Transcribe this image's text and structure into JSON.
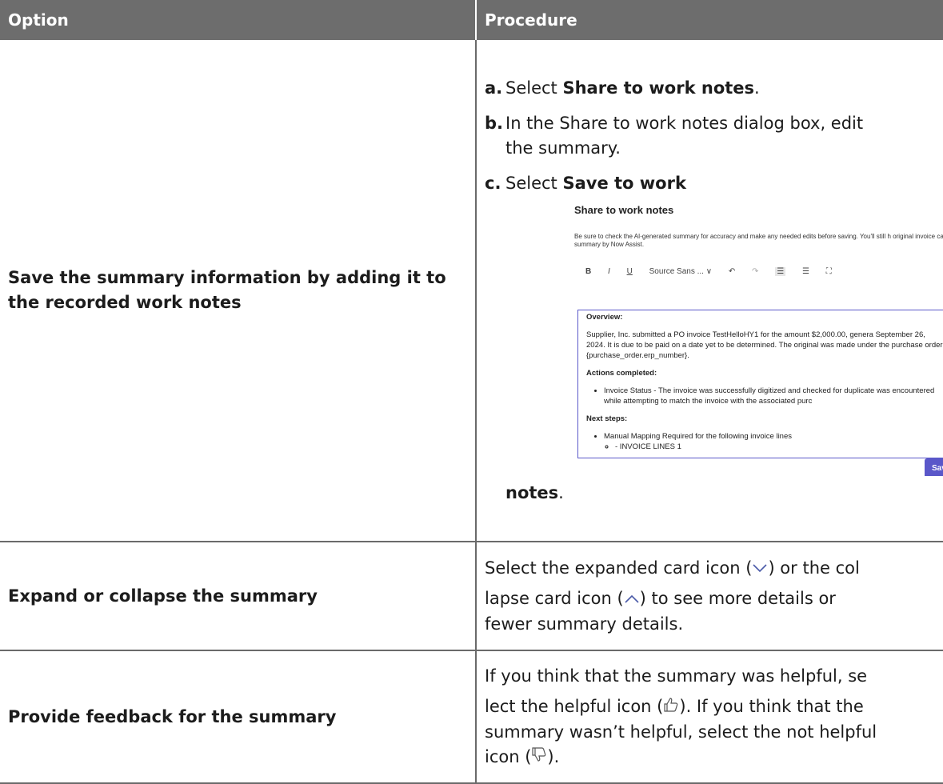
{
  "header": {
    "option": "Option",
    "procedure": "Procedure"
  },
  "rows": [
    {
      "option": "Save the summary information by adding it to the recorded work notes",
      "steps": [
        {
          "label": "a.",
          "pre": "Select ",
          "bold": "Share to work notes",
          "post": "."
        },
        {
          "label": "b.",
          "line1": "In the Share to work notes dialog box, edit",
          "line2": "the summary."
        },
        {
          "label": "c.",
          "pre": "Select ",
          "bold": "Save to work",
          "bold2": "notes",
          "post": "."
        }
      ],
      "screenshot": {
        "title": "Share to work notes",
        "desc": "Be sure to check the AI-generated summary for accuracy and make any needed edits before saving. You'll still h original invoice case summary by Now Assist.",
        "toolbar": {
          "bold": "B",
          "italic": "I",
          "underline": "U",
          "font": "Source Sans ... ∨"
        },
        "overview_h": "Overview:",
        "overview_p": "Supplier, Inc. submitted a PO invoice TestHelloHY1 for the amount $2,000.00, genera September 26, 2024. It is due to be paid on a date yet to be determined. The original was made under the purchase order {purchase_order.erp_number}.",
        "actions_h": "Actions completed:",
        "actions_item": "Invoice Status - The invoice was successfully digitized and checked for duplicate was encountered while attempting to match the invoice with the associated purc",
        "next_h": "Next steps:",
        "next_item": "Manual Mapping Required for the following invoice lines",
        "next_sub": "- INVOICE LINES 1",
        "save_btn": "Sav"
      }
    },
    {
      "option": "Expand or collapse the summary",
      "l1a": "Select the expanded card icon (",
      "l1b": ") or the col",
      "l2a": "lapse card icon (",
      "l2b": ") to see more details or",
      "l3": "fewer summary details."
    },
    {
      "option": "Provide feedback for the summary",
      "l1": "If you think that the summary was helpful, se",
      "l2a": "lect the helpful icon (",
      "l2b": "). If you think that the",
      "l3": "summary wasn’t helpful, select the not helpful",
      "l4a": "icon (",
      "l4b": ")."
    }
  ]
}
